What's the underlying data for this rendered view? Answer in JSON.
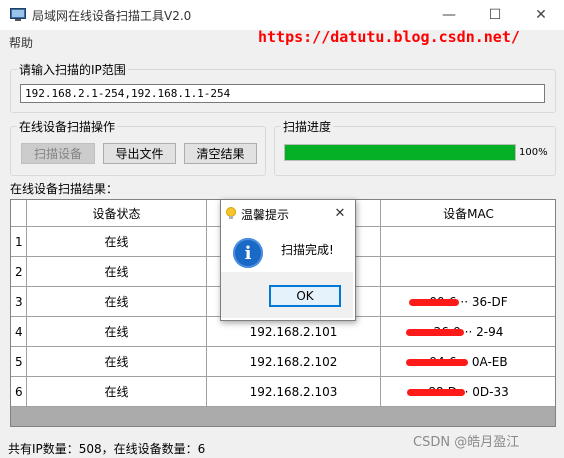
{
  "window": {
    "title": "局域网在线设备扫描工具V2.0"
  },
  "menu": {
    "help": "帮助"
  },
  "watermark_top": "https://datutu.blog.csdn.net/",
  "range_group": {
    "legend": "请输入扫描的IP范围",
    "value": "192.168.2.1-254,192.168.1.1-254"
  },
  "ops_group": {
    "legend": "在线设备扫描操作",
    "scan": "扫描设备",
    "export": "导出文件",
    "clear": "清空结果"
  },
  "progress_group": {
    "legend": "扫描进度",
    "percent": 100,
    "label": "100%"
  },
  "results": {
    "label": "在线设备扫描结果：",
    "columns": [
      "设备状态",
      "设备MAC"
    ],
    "rows": [
      {
        "num": "1",
        "status": "在线",
        "ip": "",
        "mac": ""
      },
      {
        "num": "2",
        "status": "在线",
        "ip": "",
        "mac": ""
      },
      {
        "num": "3",
        "status": "在线",
        "ip": "",
        "mac": "00-6 ·· 36-DF"
      },
      {
        "num": "4",
        "status": "在线",
        "ip": "192.168.2.101",
        "mac": "26-9 ·· 2-94"
      },
      {
        "num": "5",
        "status": "在线",
        "ip": "192.168.2.102",
        "mac": "94-6 ·· 0A-EB"
      },
      {
        "num": "6",
        "status": "在线",
        "ip": "192.168.2.103",
        "mac": "88-D ·· 0D-33"
      }
    ]
  },
  "status_bar": "共有IP数量：508，在线设备数量：6",
  "watermark_bottom": "CSDN @皓月盈江",
  "dialog": {
    "title": "温馨提示",
    "message": "扫描完成!",
    "ok": "OK"
  }
}
